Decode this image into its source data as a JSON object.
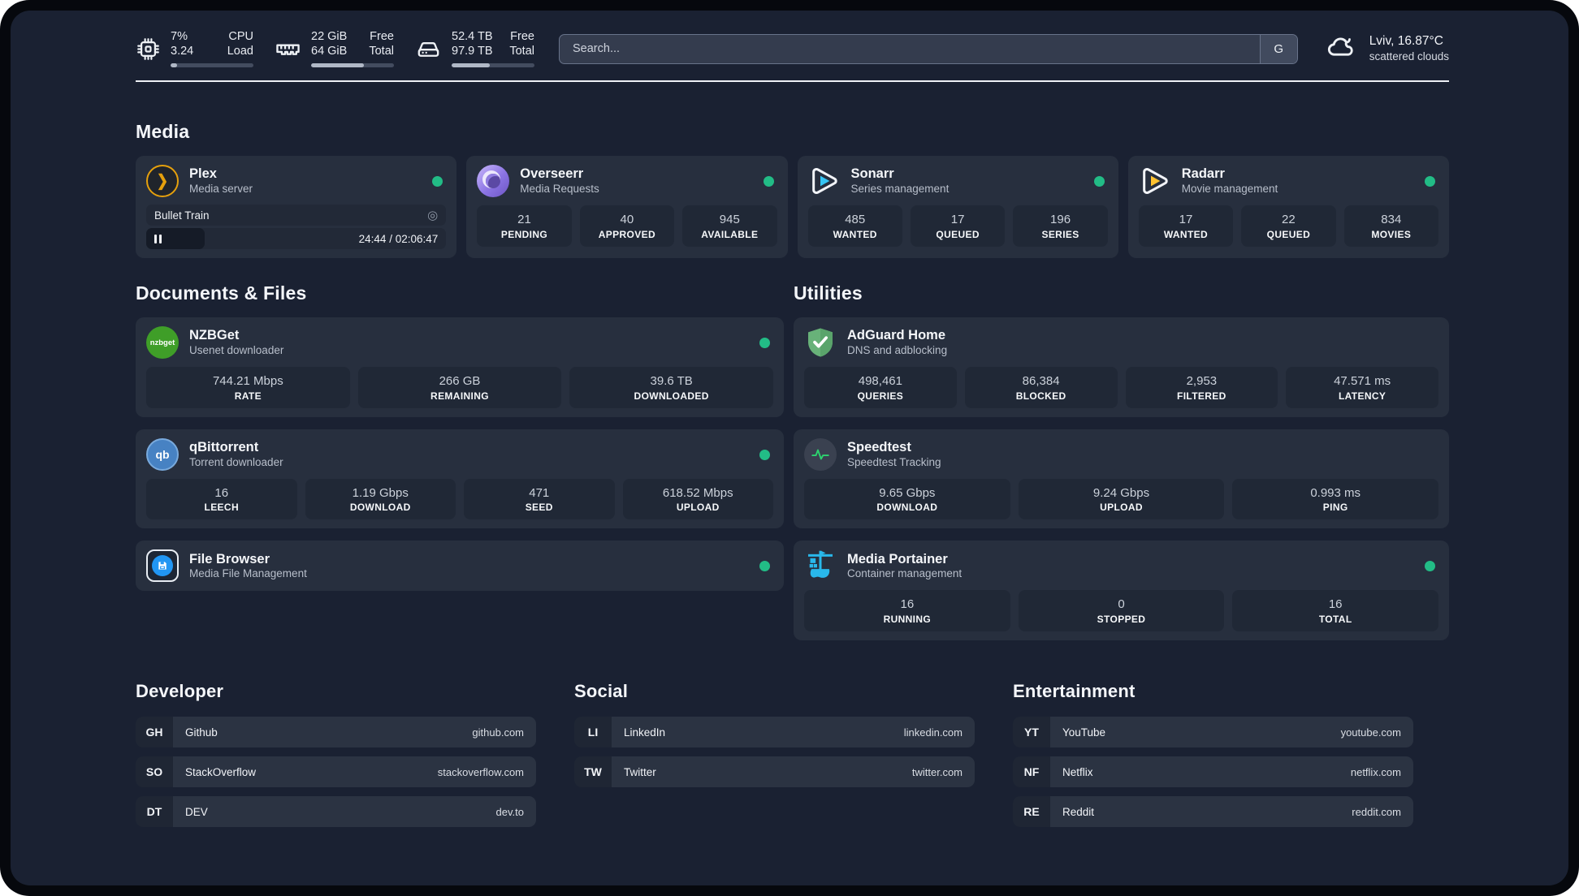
{
  "colors": {
    "status_online": "#22bc86",
    "accent_plex": "#e5a00d",
    "sonarr_blue": "#35c5f4",
    "radarr_yellow": "#ffc230",
    "portainer_blue": "#29b8eb",
    "adguard_green": "#68b279",
    "speedtest_green": "#2dd36f"
  },
  "topbar": {
    "cpu": {
      "primary": "7%",
      "secondary": "3.24",
      "label_primary": "CPU",
      "label_secondary": "Load",
      "progress_pct": 8
    },
    "memory": {
      "primary": "22 GiB",
      "secondary": "64 GiB",
      "label_primary": "Free",
      "label_secondary": "Total",
      "progress_pct": 64
    },
    "storage": {
      "primary": "52.4 TB",
      "secondary": "97.9 TB",
      "label_primary": "Free",
      "label_secondary": "Total",
      "progress_pct": 46
    },
    "search": {
      "placeholder": "Search...",
      "engine": "G"
    },
    "weather": {
      "headline": "Lviv, 16.87°C",
      "condition": "scattered clouds"
    }
  },
  "icon_labels": {
    "nzbget": "nzbget",
    "qbittorrent": "qb",
    "plex_chevron": "❯",
    "session_glyph": "◎"
  },
  "sections": {
    "media": {
      "title": "Media",
      "apps": [
        {
          "name": "Plex",
          "subtitle": "Media server",
          "online": true,
          "now_playing": {
            "title": "Bullet Train",
            "time": "24:44 / 02:06:47",
            "progress_pct": 19.5
          }
        },
        {
          "name": "Overseerr",
          "subtitle": "Media Requests",
          "online": true,
          "stats": [
            {
              "value": "21",
              "label": "PENDING"
            },
            {
              "value": "40",
              "label": "APPROVED"
            },
            {
              "value": "945",
              "label": "AVAILABLE"
            }
          ]
        },
        {
          "name": "Sonarr",
          "subtitle": "Series management",
          "online": true,
          "stats": [
            {
              "value": "485",
              "label": "WANTED"
            },
            {
              "value": "17",
              "label": "QUEUED"
            },
            {
              "value": "196",
              "label": "SERIES"
            }
          ]
        },
        {
          "name": "Radarr",
          "subtitle": "Movie management",
          "online": true,
          "stats": [
            {
              "value": "17",
              "label": "WANTED"
            },
            {
              "value": "22",
              "label": "QUEUED"
            },
            {
              "value": "834",
              "label": "MOVIES"
            }
          ]
        }
      ]
    },
    "documents": {
      "title": "Documents & Files",
      "apps": [
        {
          "name": "NZBGet",
          "subtitle": "Usenet downloader",
          "online": true,
          "stats": [
            {
              "value": "744.21 Mbps",
              "label": "RATE"
            },
            {
              "value": "266 GB",
              "label": "REMAINING"
            },
            {
              "value": "39.6 TB",
              "label": "DOWNLOADED"
            }
          ]
        },
        {
          "name": "qBittorrent",
          "subtitle": "Torrent downloader",
          "online": true,
          "stats": [
            {
              "value": "16",
              "label": "LEECH"
            },
            {
              "value": "1.19 Gbps",
              "label": "DOWNLOAD"
            },
            {
              "value": "471",
              "label": "SEED"
            },
            {
              "value": "618.52 Mbps",
              "label": "UPLOAD"
            }
          ]
        },
        {
          "name": "File Browser",
          "subtitle": "Media File Management",
          "online": true
        }
      ]
    },
    "utilities": {
      "title": "Utilities",
      "apps": [
        {
          "name": "AdGuard Home",
          "subtitle": "DNS and adblocking",
          "stats": [
            {
              "value": "498,461",
              "label": "QUERIES"
            },
            {
              "value": "86,384",
              "label": "BLOCKED"
            },
            {
              "value": "2,953",
              "label": "FILTERED"
            },
            {
              "value": "47.571 ms",
              "label": "LATENCY"
            }
          ]
        },
        {
          "name": "Speedtest",
          "subtitle": "Speedtest Tracking",
          "stats": [
            {
              "value": "9.65 Gbps",
              "label": "DOWNLOAD"
            },
            {
              "value": "9.24 Gbps",
              "label": "UPLOAD"
            },
            {
              "value": "0.993 ms",
              "label": "PING"
            }
          ]
        },
        {
          "name": "Media Portainer",
          "subtitle": "Container management",
          "online": true,
          "stats": [
            {
              "value": "16",
              "label": "RUNNING"
            },
            {
              "value": "0",
              "label": "STOPPED"
            },
            {
              "value": "16",
              "label": "TOTAL"
            }
          ]
        }
      ]
    }
  },
  "bookmarks": [
    {
      "title": "Developer",
      "links": [
        {
          "abbr": "GH",
          "name": "Github",
          "url": "github.com"
        },
        {
          "abbr": "SO",
          "name": "StackOverflow",
          "url": "stackoverflow.com"
        },
        {
          "abbr": "DT",
          "name": "DEV",
          "url": "dev.to"
        }
      ]
    },
    {
      "title": "Social",
      "links": [
        {
          "abbr": "LI",
          "name": "LinkedIn",
          "url": "linkedin.com"
        },
        {
          "abbr": "TW",
          "name": "Twitter",
          "url": "twitter.com"
        }
      ]
    },
    {
      "title": "Entertainment",
      "links": [
        {
          "abbr": "YT",
          "name": "YouTube",
          "url": "youtube.com"
        },
        {
          "abbr": "NF",
          "name": "Netflix",
          "url": "netflix.com"
        },
        {
          "abbr": "RE",
          "name": "Reddit",
          "url": "reddit.com"
        }
      ]
    }
  ]
}
